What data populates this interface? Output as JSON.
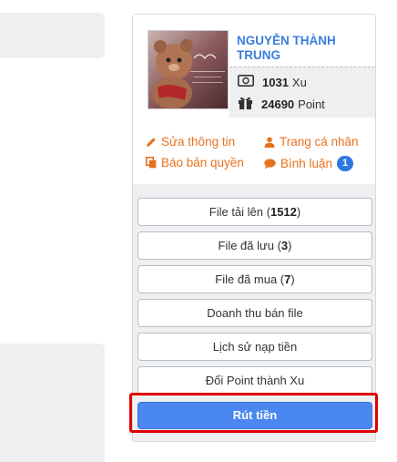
{
  "user": {
    "name": "NGUYỄN THÀNH TRUNG",
    "xu_value": "1031",
    "xu_unit": "Xu",
    "point_value": "24690",
    "point_unit": "Point"
  },
  "links": {
    "edit": "Sửa thông tin",
    "personal": "Trang cá nhân",
    "copyright": "Báo bản quyền",
    "comments": "Bình luận",
    "comments_count": "1"
  },
  "menu": {
    "uploaded_label": "File tải lên (",
    "uploaded_count": "1512",
    "saved_label": "File đã lưu (",
    "saved_count": "3",
    "bought_label": "File đã mua (",
    "bought_count": "7",
    "close_paren": ")",
    "revenue": "Doanh thu bán file",
    "topup_history": "Lịch sử nạp tiền",
    "convert": "Đổi Point thành Xu",
    "withdraw": "Rút tiền"
  },
  "colors": {
    "accent_link": "#e8711d",
    "name_blue": "#3b7ddd",
    "primary_button": "#4a87f0",
    "highlight_red": "#e10000"
  }
}
